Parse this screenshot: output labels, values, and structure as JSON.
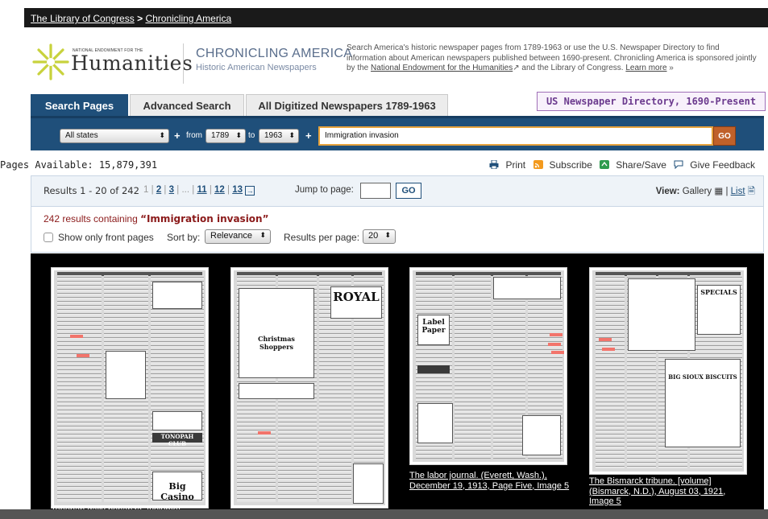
{
  "topbar": {
    "loc": "The Library of Congress",
    "sep": ">",
    "ca": "Chronicling America"
  },
  "header": {
    "neh_small": "NATIONAL ENDOWMENT FOR THE",
    "neh_big": "Humanities",
    "title": "CHRONICLING AMERICA",
    "subtitle": "Historic American Newspapers",
    "desc1": "Search America's historic newspaper pages from 1789-1963 or use the U.S. Newspaper Directory to find information about American newspapers published between 1690-present. Chronicling America is sponsored jointly by the ",
    "desc_link": "National Endowment for the Humanities",
    "desc2": " and the Library of Congress. ",
    "learn_more": "Learn more",
    "learn_more_suffix": " »"
  },
  "tabs": [
    "Search Pages",
    "Advanced Search",
    "All Digitized Newspapers 1789-1963"
  ],
  "directory_button": "US Newspaper Directory, 1690-Present",
  "search": {
    "state": "All states",
    "plus": "+",
    "from_label": "from",
    "from_year": "1789",
    "to_label": "to",
    "to_year": "1963",
    "query": "Immigration invasion",
    "go": "GO"
  },
  "pages_available": "Pages Available: 15,879,391",
  "tools": {
    "print": "Print",
    "subscribe": "Subscribe",
    "share": "Share/Save",
    "feedback": "Give Feedback"
  },
  "results": {
    "count": "Results 1 - 20 of 242",
    "pages": [
      "1",
      "2",
      "3",
      "...",
      "11",
      "12",
      "13"
    ],
    "sep": "|",
    "jump_label": "Jump to page:",
    "jump_go": "GO",
    "view_label": "View:",
    "gallery": "Gallery",
    "list": "List",
    "summary_prefix": "242 results containing ",
    "summary_query": "“Immigration invasion”",
    "front_pages": "Show only front pages",
    "sort_label": "Sort by:",
    "sort_value": "Relevance",
    "rpp_label": "Results per page:",
    "rpp_value": "20"
  },
  "gallery_items": [
    {
      "caption": "Tonopah daily bonanza. [volume]"
    },
    {
      "caption": ""
    },
    {
      "caption": "The labor journal. (Everett, Wash.), December 19, 1913, Page Five, Image 5"
    },
    {
      "caption": "The Bismarck tribune. [volume] (Bismarck, N.D.), August 03, 1921, Image 5"
    }
  ],
  "thumb_text": {
    "royal": "ROYAL",
    "label_paper": "Label Paper",
    "specials": "SPECIALS",
    "sioux": "BIG SIOUX BISCUITS",
    "big_casino": "Big Casino",
    "tonopah_club": "TONOPAH CLUB",
    "christmas": "Christmas Shoppers"
  },
  "colors": {
    "nav_blue": "#1f4f7a",
    "go_orange": "#c0612a",
    "highlight": "#f2746b",
    "summary_red": "#8b1a1a"
  }
}
